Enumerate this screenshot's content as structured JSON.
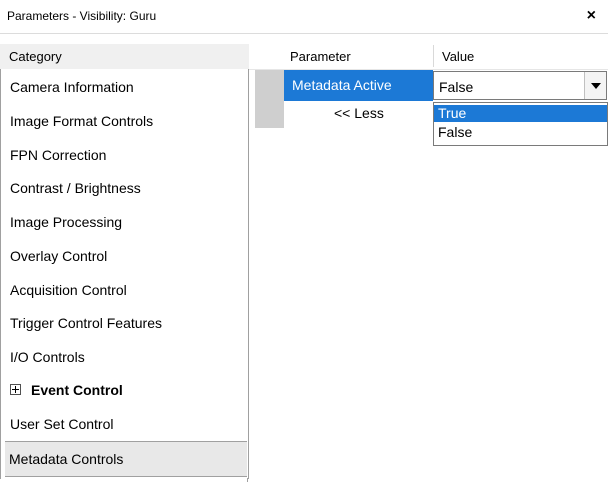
{
  "window": {
    "title": "Parameters - Visibility: Guru",
    "close_icon": "×"
  },
  "categories": {
    "header": "Category",
    "items": [
      {
        "label": "Camera Information"
      },
      {
        "label": "Image Format Controls"
      },
      {
        "label": "FPN Correction"
      },
      {
        "label": "Contrast / Brightness"
      },
      {
        "label": "Image Processing"
      },
      {
        "label": "Overlay Control"
      },
      {
        "label": "Acquisition Control"
      },
      {
        "label": "Trigger Control Features"
      },
      {
        "label": "I/O Controls"
      },
      {
        "label": "Event Control",
        "expandable": true
      },
      {
        "label": "User Set Control"
      },
      {
        "label": "Metadata Controls",
        "selected": true
      }
    ]
  },
  "grid": {
    "param_header": "Parameter",
    "value_header": "Value",
    "row": {
      "parameter": "Metadata Active",
      "value": "False"
    },
    "less_label": "<< Less"
  },
  "dropdown": {
    "options": [
      "True",
      "False"
    ],
    "highlighted": "True"
  },
  "colors": {
    "selection_blue": "#1c79d6"
  }
}
